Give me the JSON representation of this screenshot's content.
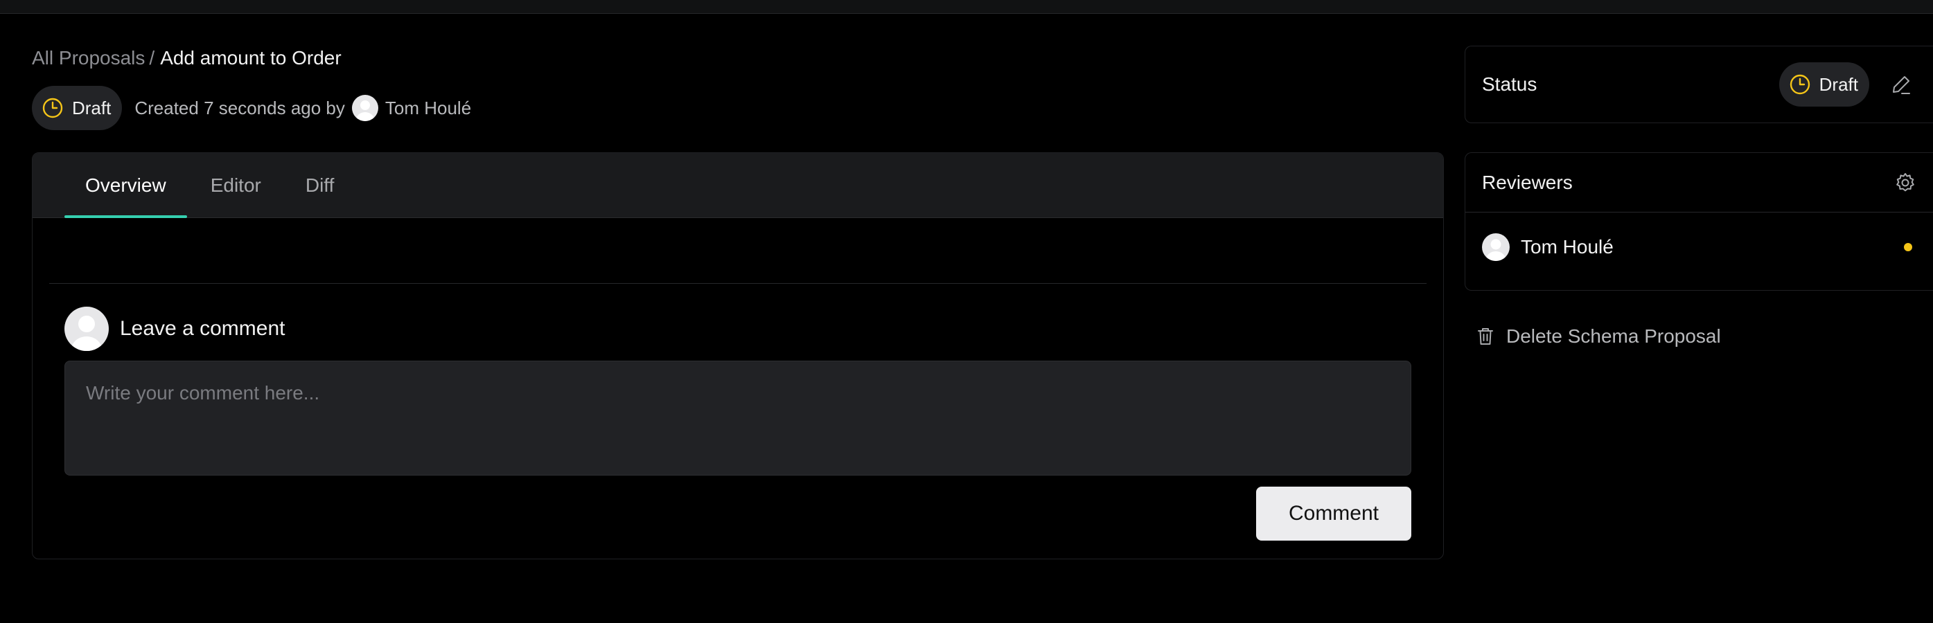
{
  "breadcrumb": {
    "parent": "All Proposals",
    "separator": "/",
    "current": "Add amount to Order"
  },
  "meta": {
    "status_label": "Draft",
    "created_text": "Created 7 seconds ago by",
    "author": "Tom Houlé"
  },
  "tabs": [
    {
      "label": "Overview",
      "active": true
    },
    {
      "label": "Editor",
      "active": false
    },
    {
      "label": "Diff",
      "active": false
    }
  ],
  "comment": {
    "title": "Leave a comment",
    "placeholder": "Write your comment here...",
    "button_label": "Comment"
  },
  "status_card": {
    "title": "Status",
    "value": "Draft"
  },
  "reviewers_card": {
    "title": "Reviewers",
    "reviewers": [
      {
        "name": "Tom Houlé",
        "status_color": "#f5c518"
      }
    ]
  },
  "delete": {
    "label": "Delete Schema Proposal"
  },
  "colors": {
    "accent": "#35d0b0",
    "draft_icon": "#f5c518",
    "background": "#000000"
  },
  "icons": {
    "status": "clock-icon",
    "edit": "pencil-icon",
    "settings": "gear-icon",
    "delete": "trash-icon",
    "user": "avatar-icon"
  }
}
